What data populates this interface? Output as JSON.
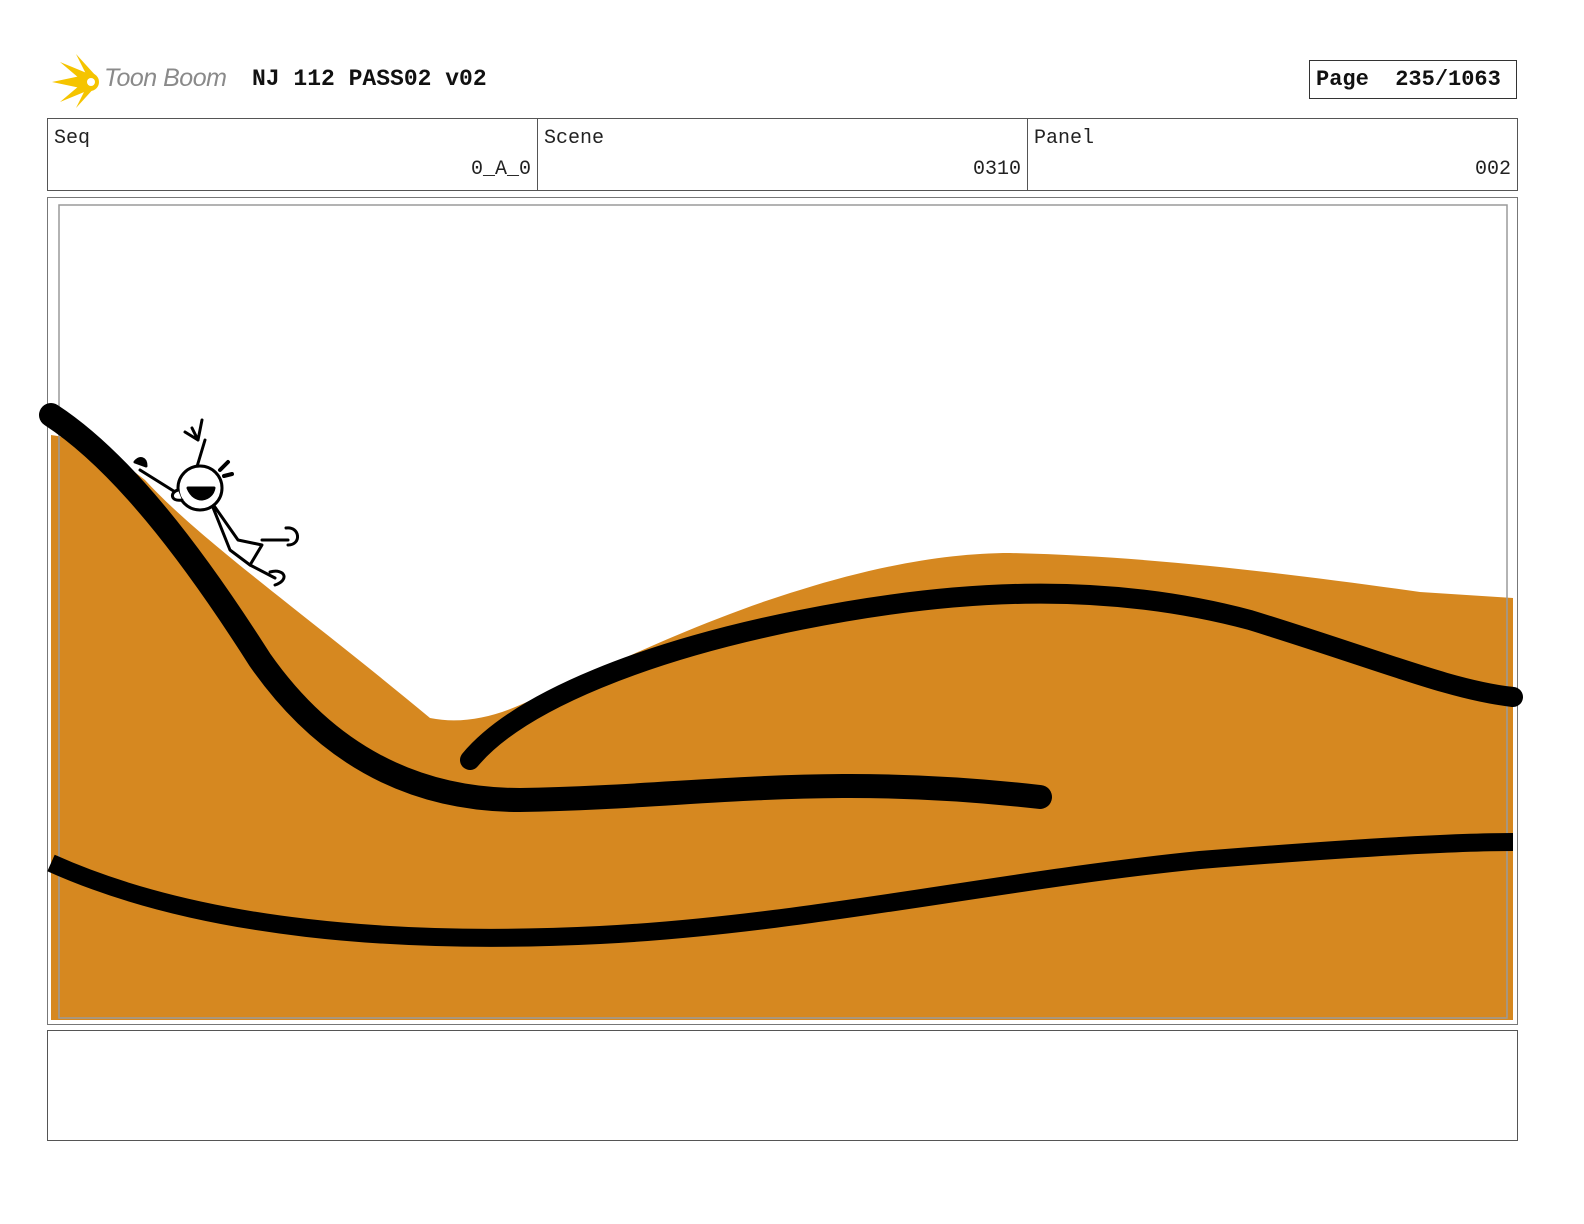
{
  "header": {
    "logo_text": "Toon Boom",
    "project_title": "NJ 112 PASS02 v02",
    "page_label": "Page",
    "page_value": "235/1063"
  },
  "info": {
    "seq": {
      "label": "Seq",
      "value": "0_A_0"
    },
    "scene": {
      "label": "Scene",
      "value": "0310"
    },
    "panel": {
      "label": "Panel",
      "value": "002"
    }
  },
  "drawing": {
    "colors": {
      "ground": "#d68820",
      "outline": "#000000",
      "logo_accent": "#f5c400"
    }
  },
  "notes": {
    "text": ""
  }
}
